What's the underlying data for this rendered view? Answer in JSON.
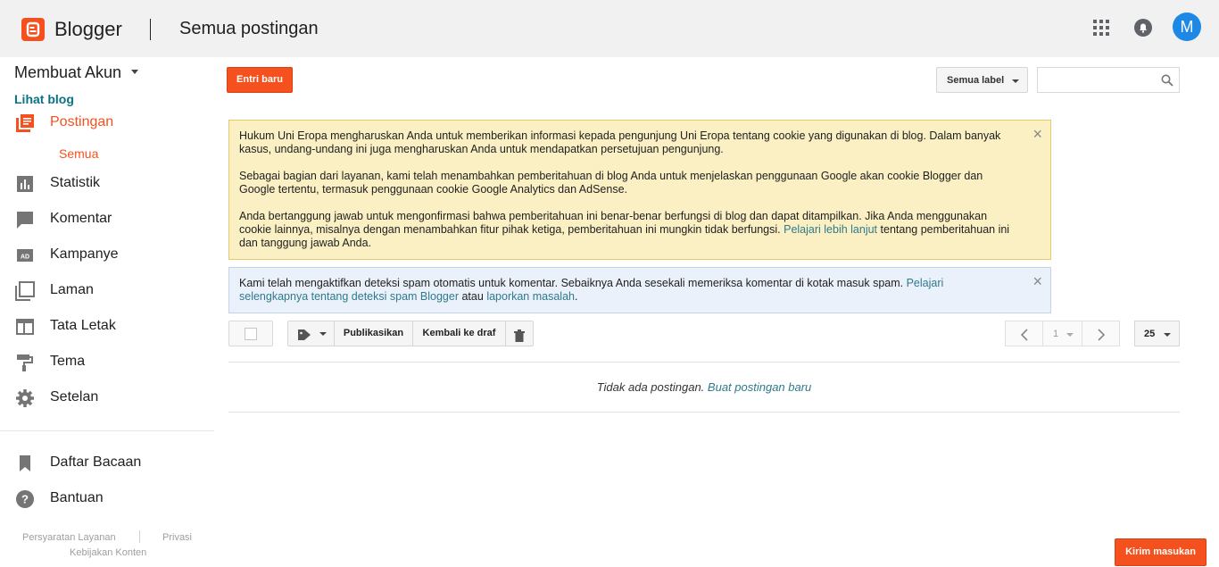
{
  "header": {
    "app_name": "Blogger",
    "page_title": "Semua postingan",
    "avatar_initial": "M",
    "brand_color": "#f4511e",
    "icons": [
      "blogger-logo-icon",
      "apps-grid-icon",
      "notifications-bell-icon"
    ]
  },
  "sidebar": {
    "blog_name": "Membuat Akun",
    "view_blog": "Lihat blog",
    "items": [
      {
        "label": "Postingan",
        "icon": "posts-icon",
        "active": true
      },
      {
        "label": "Statistik",
        "icon": "stats-icon"
      },
      {
        "label": "Komentar",
        "icon": "comments-icon"
      },
      {
        "label": "Kampanye",
        "icon": "campaign-icon"
      },
      {
        "label": "Laman",
        "icon": "pages-icon"
      },
      {
        "label": "Tata Letak",
        "icon": "layout-icon"
      },
      {
        "label": "Tema",
        "icon": "theme-icon"
      },
      {
        "label": "Setelan",
        "icon": "settings-gear-icon"
      }
    ],
    "sub_item": "Semua",
    "bottom_items": [
      {
        "label": "Daftar Bacaan",
        "icon": "bookmark-icon"
      },
      {
        "label": "Bantuan",
        "icon": "help-icon"
      }
    ],
    "footer": {
      "tos": "Persyaratan Layanan",
      "privacy": "Privasi",
      "content_policy": "Kebijakan Konten"
    }
  },
  "toolbar": {
    "new_post": "Entri baru",
    "label_filter": "Semua label",
    "search_placeholder": ""
  },
  "notices": {
    "cookie": {
      "p1": "Hukum Uni Eropa mengharuskan Anda untuk memberikan informasi kepada pengunjung Uni Eropa tentang cookie yang digunakan di blog. Dalam banyak kasus, undang-undang ini juga mengharuskan Anda untuk mendapatkan persetujuan pengunjung.",
      "p2": "Sebagai bagian dari layanan, kami telah menambahkan pemberitahuan di blog Anda untuk menjelaskan penggunaan Google akan cookie Blogger dan Google tertentu, termasuk penggunaan cookie Google Analytics dan AdSense.",
      "p3": "Anda bertanggung jawab untuk mengonfirmasi bahwa pemberitahuan ini benar-benar berfungsi di blog dan dapat ditampilkan. Jika Anda menggunakan cookie lainnya, misalnya dengan menambahkan fitur pihak ketiga, pemberitahuan ini mungkin tidak berfungsi.",
      "p3_link": "Pelajari lebih lanjut",
      "p3_tail": "tentang pemberitahuan ini dan tanggung jawab Anda."
    },
    "spam": {
      "text": "Kami telah mengaktifkan deteksi spam otomatis untuk komentar. Sebaiknya Anda sesekali memeriksa komentar di kotak masuk spam.",
      "link1": "Pelajari selengkapnya tentang deteksi spam Blogger",
      "mid": "atau",
      "link2": "laporkan masalah",
      "end": "."
    },
    "close": "×"
  },
  "list_toolbar": {
    "publish": "Publikasikan",
    "revert": "Kembali ke draf",
    "page": "1",
    "per_page": "25"
  },
  "empty": {
    "text": "Tidak ada postingan.",
    "link": "Buat postingan baru"
  },
  "feedback": "Kirim masukan"
}
